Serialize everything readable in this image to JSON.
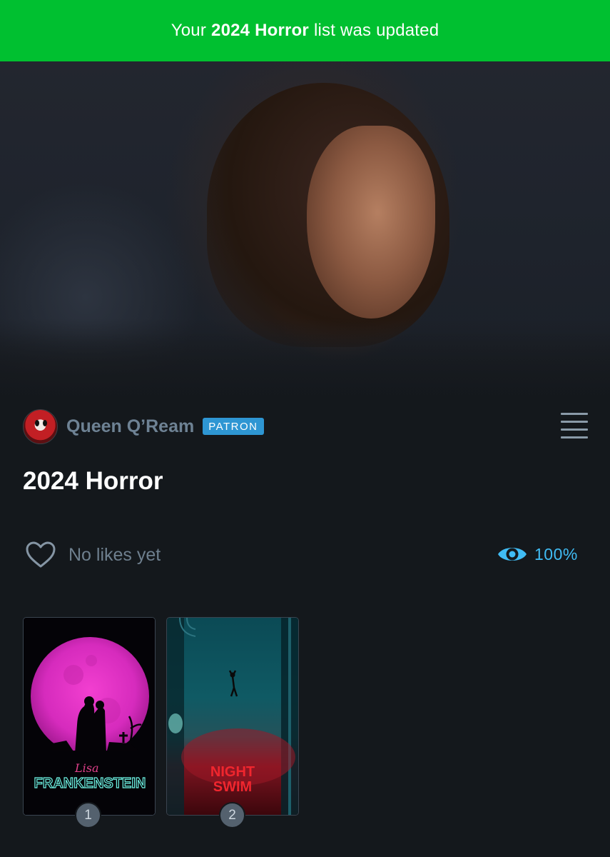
{
  "banner": {
    "prefix": "Your",
    "list_name": "2024 Horror",
    "suffix": "list was updated",
    "color": "#00c030"
  },
  "owner": {
    "name": "Queen Q’Ream",
    "badge": "PATRON",
    "avatar_icon": "avatar-icon"
  },
  "list": {
    "title": "2024 Horror"
  },
  "stats": {
    "likes_text": "No likes yet",
    "watched_percent": "100%"
  },
  "films": [
    {
      "position": "1",
      "poster_title": "Lisa Frankenstein",
      "poster_text_script": "Lisa",
      "poster_text_main": "FRANKENSTEIN"
    },
    {
      "position": "2",
      "poster_title": "Night Swim",
      "poster_text_line1": "NIGHT",
      "poster_text_line2": "SWIM"
    }
  ],
  "colors": {
    "background": "#14181c",
    "accent_blue": "#40bcf4",
    "badge_blue": "#2e96d3",
    "muted_text": "#6e8294"
  }
}
